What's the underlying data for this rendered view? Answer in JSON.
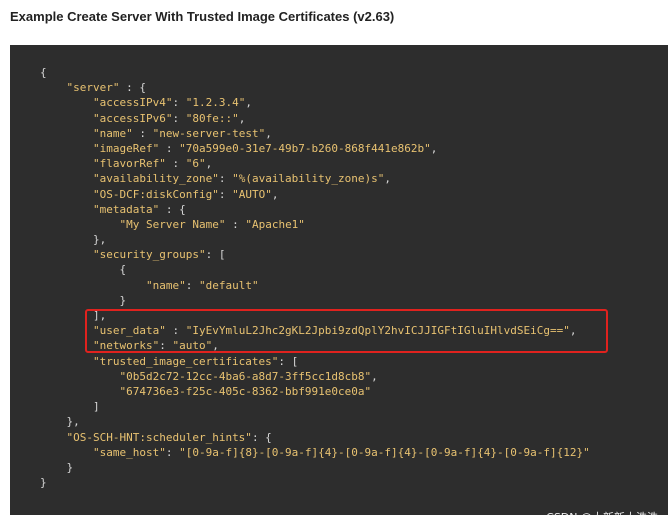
{
  "title": "Example Create Server With Trusted Image Certificates (v2.63)",
  "code_lines": [
    "{",
    "    \"server\" : {",
    "        \"accessIPv4\": \"1.2.3.4\",",
    "        \"accessIPv6\": \"80fe::\",",
    "        \"name\" : \"new-server-test\",",
    "        \"imageRef\" : \"70a599e0-31e7-49b7-b260-868f441e862b\",",
    "        \"flavorRef\" : \"6\",",
    "        \"availability_zone\": \"%(availability_zone)s\",",
    "        \"OS-DCF:diskConfig\": \"AUTO\",",
    "        \"metadata\" : {",
    "            \"My Server Name\" : \"Apache1\"",
    "        },",
    "        \"security_groups\": [",
    "            {",
    "                \"name\": \"default\"",
    "            }",
    "        ],",
    "        \"user_data\" : \"IyEvYmluL2Jhc2gKL2Jpbi9zdQplY2hvICJJIGFtIGluIHlvdSEiCg==\",",
    "        \"networks\": \"auto\",",
    "        \"trusted_image_certificates\": [",
    "            \"0b5d2c72-12cc-4ba6-a8d7-3ff5cc1d8cb8\",",
    "            \"674736e3-f25c-405c-8362-bbf991e0ce0a\"",
    "        ]",
    "    },",
    "    \"OS-SCH-HNT:scheduler_hints\": {",
    "        \"same_host\": \"[0-9a-f]{8}-[0-9a-f]{4}-[0-9a-f]{4}-[0-9a-f]{4}-[0-9a-f]{12}\"",
    "    }",
    "}"
  ],
  "watermark": "CSDN @大新新大浩浩",
  "colors": {
    "code_background": "#2d2d2d",
    "code_string": "#e8c271",
    "code_punct": "#d6d6d6",
    "highlight_border": "#e0221e"
  }
}
